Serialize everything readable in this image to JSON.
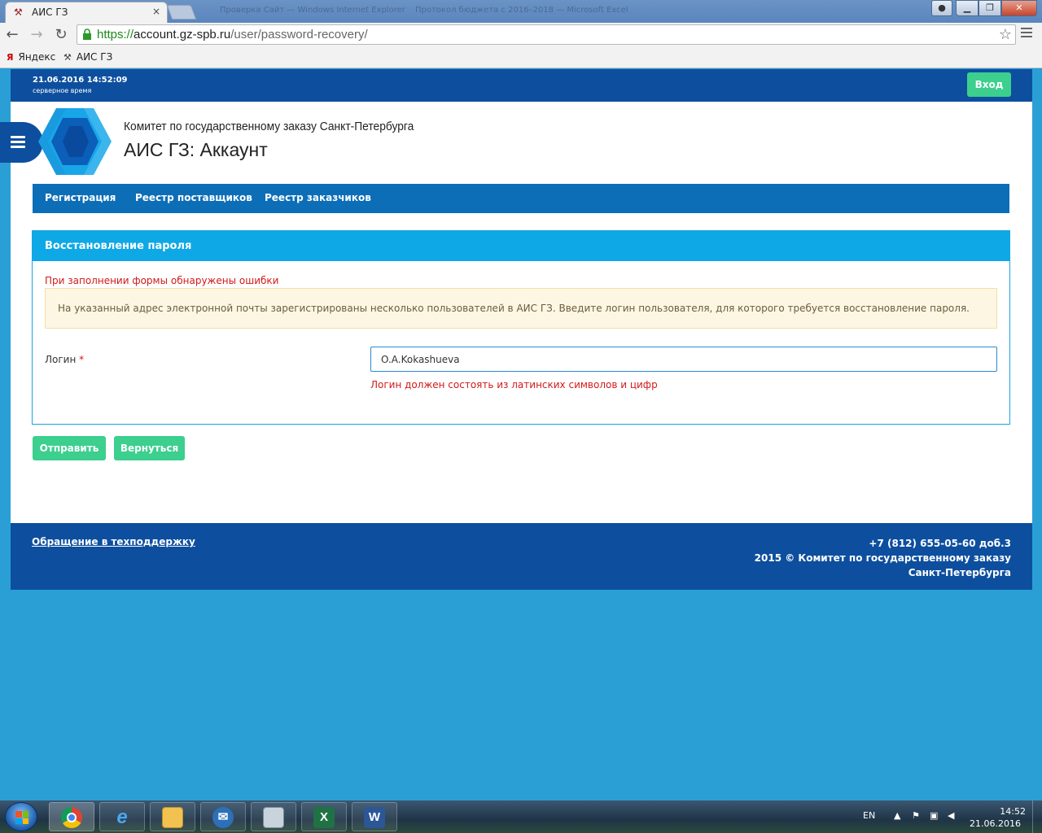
{
  "browser": {
    "tab_title": "АИС ГЗ",
    "tab_close": "×",
    "ghost_tab_text_1": "Проверка Сайт — Windows Internet Explorer",
    "ghost_tab_text_2": "Протокол бюджета с 2016–2018 — Microsoft Excel",
    "url_scheme": "https://",
    "url_host": "account.gz-spb.ru",
    "url_path": "/user/password-recovery/",
    "bookmarks": [
      {
        "icon": "Я",
        "label": "Яндекс"
      },
      {
        "icon": "⚒",
        "label": "АИС ГЗ"
      }
    ]
  },
  "header": {
    "server_time": "21.06.2016 14:52:09",
    "server_time_label": "серверное время",
    "login_button": "Вход",
    "org_name": "Комитет по государственному заказу Санкт-Петербурга",
    "app_title": "АИС ГЗ: Аккаунт"
  },
  "nav": {
    "items": [
      {
        "label": "Регистрация"
      },
      {
        "label": "Реестр поставщиков"
      },
      {
        "label": "Реестр заказчиков"
      }
    ]
  },
  "form": {
    "panel_title": "Восстановление пароля",
    "form_error": "При заполнении формы обнаружены ошибки",
    "alert_text": "На указанный адрес электронной почты зарегистрированы несколько пользователей в АИС ГЗ. Введите логин пользователя, для которого требуется восстановление пароля.",
    "login_label": "Логин",
    "required_mark": "*",
    "login_value": "O.A.Kokashueva",
    "login_error": "Логин должен состоять из латинских символов и цифр",
    "submit_button": "Отправить",
    "back_button": "Вернуться"
  },
  "footer": {
    "support_link": "Обращение в техподдержку",
    "phone": "+7 (812) 655-05-60 доб.3",
    "copyright": "2015 © Комитет по государственному заказу Санкт-Петербурга"
  },
  "taskbar": {
    "lang": "EN",
    "time": "14:52",
    "date": "21.06.2016"
  },
  "colors": {
    "dark_blue": "#0d4f9e",
    "nav_blue": "#0d6eb8",
    "panel_blue": "#0fa8e6",
    "green": "#3ccf8e",
    "error_red": "#d11a1a"
  }
}
